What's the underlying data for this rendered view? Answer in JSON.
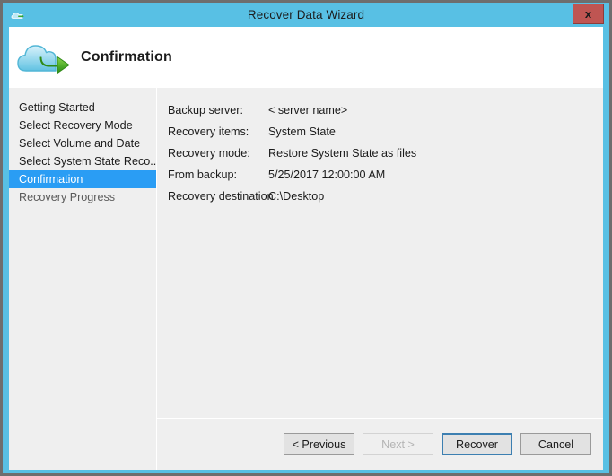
{
  "window": {
    "title": "Recover Data Wizard",
    "icon": "cloud-icon",
    "close_label": "x",
    "colors": {
      "title_bar": "#58c0e4",
      "frame": "#6e6e6e",
      "close_button": "#bf5552",
      "selection": "#2a9df4",
      "focus_border": "#3c7fb1",
      "panel": "#efefef"
    }
  },
  "header": {
    "title": "Confirmation",
    "icon": "cloud-restore-icon"
  },
  "sidebar": {
    "items": [
      {
        "label": "Getting Started",
        "state": "normal"
      },
      {
        "label": "Select Recovery Mode",
        "state": "normal"
      },
      {
        "label": "Select Volume and Date",
        "state": "normal"
      },
      {
        "label": "Select System State Reco...",
        "state": "normal"
      },
      {
        "label": "Confirmation",
        "state": "selected"
      },
      {
        "label": "Recovery Progress",
        "state": "disabled"
      }
    ]
  },
  "content": {
    "fields": [
      {
        "label": "Backup server:",
        "value": "< server name>"
      },
      {
        "label": "Recovery items:",
        "value": "System State"
      },
      {
        "label": "Recovery mode:",
        "value": "Restore System State as files"
      },
      {
        "label": "From backup:",
        "value": "5/25/2017 12:00:00 AM"
      },
      {
        "label": "Recovery destination",
        "value": "C:\\Desktop"
      }
    ]
  },
  "footer": {
    "buttons": [
      {
        "label": "< Previous",
        "state": "normal"
      },
      {
        "label": "Next >",
        "state": "disabled"
      },
      {
        "label": "Recover",
        "state": "focused"
      },
      {
        "label": "Cancel",
        "state": "normal"
      }
    ]
  }
}
